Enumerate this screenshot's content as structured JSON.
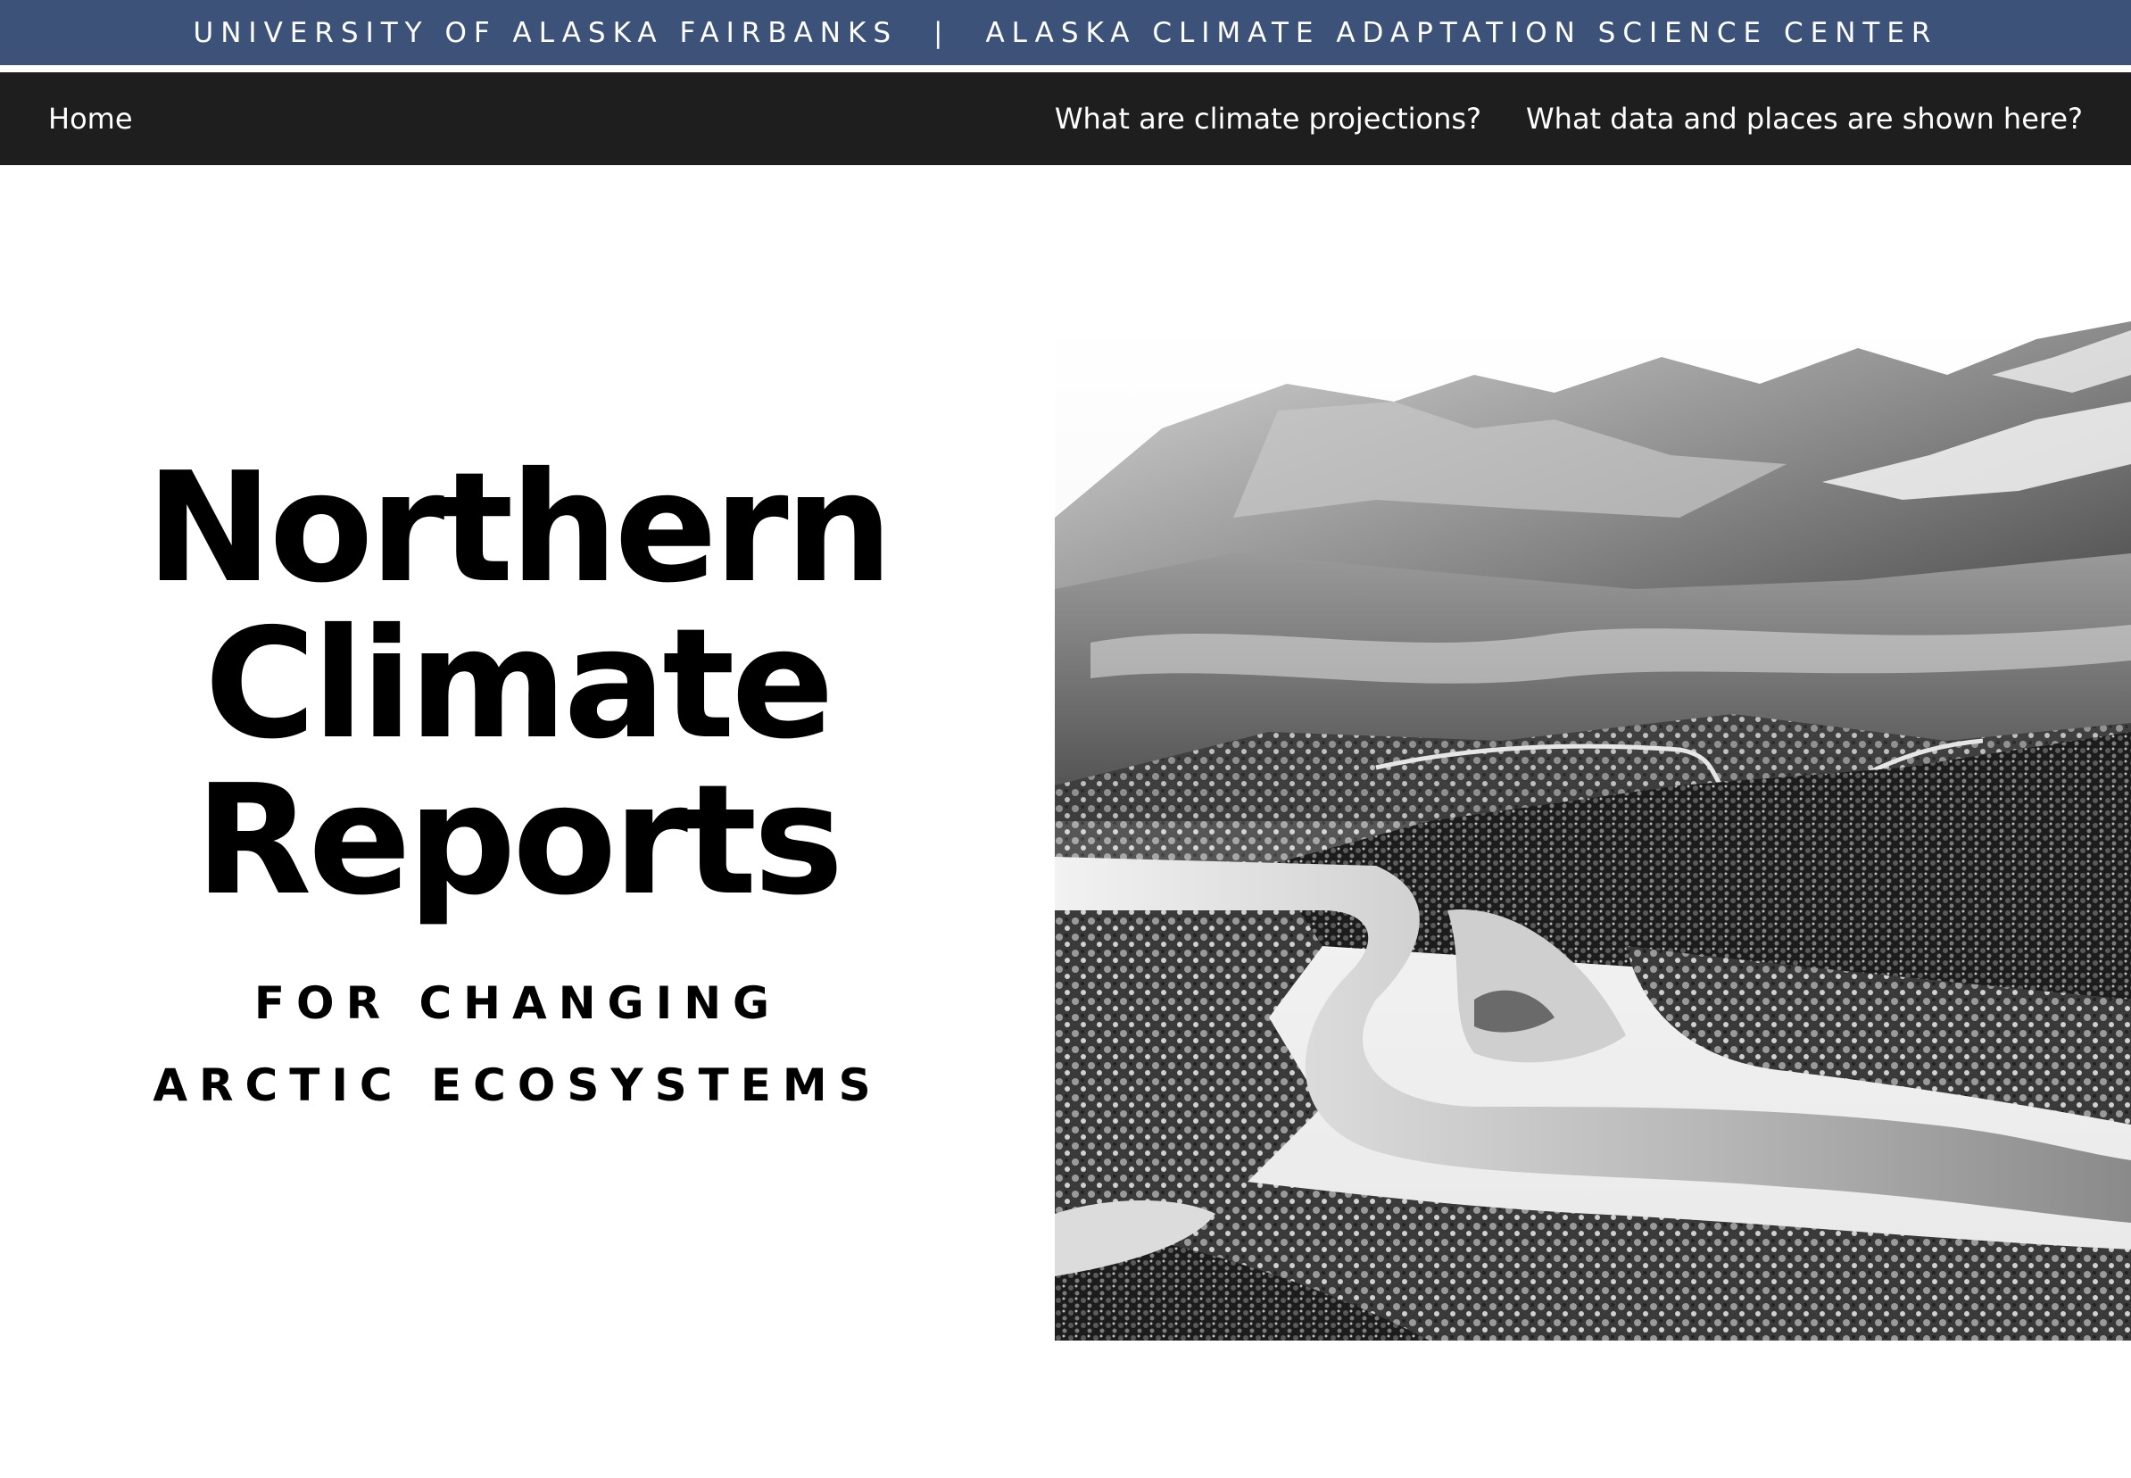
{
  "banner": {
    "left_text": "UNIVERSITY OF ALASKA FAIRBANKS",
    "separator": "|",
    "right_text": "ALASKA CLIMATE ADAPTATION SCIENCE CENTER",
    "background_color": "#3c5279"
  },
  "nav": {
    "home": "Home",
    "links": [
      "What are climate projections?",
      "What data and places are shown here?"
    ],
    "background_color": "#1e1e1e"
  },
  "hero": {
    "title_lines": [
      "Northern",
      "Climate",
      "Reports"
    ],
    "subtitle_lines": [
      "FOR CHANGING",
      "ARCTIC ECOSYSTEMS"
    ],
    "image": "black-and-white aerial landscape photo"
  }
}
